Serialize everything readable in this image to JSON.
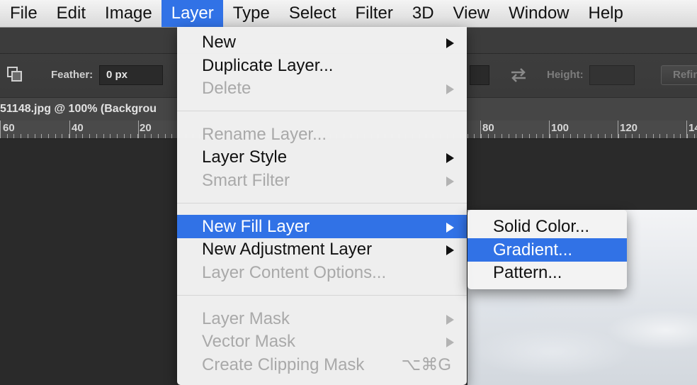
{
  "menubar": {
    "items": [
      {
        "label": "File"
      },
      {
        "label": "Edit"
      },
      {
        "label": "Image"
      },
      {
        "label": "Layer",
        "active": true
      },
      {
        "label": "Type"
      },
      {
        "label": "Select"
      },
      {
        "label": "Filter"
      },
      {
        "label": "3D"
      },
      {
        "label": "View"
      },
      {
        "label": "Window"
      },
      {
        "label": "Help"
      }
    ]
  },
  "options": {
    "feather_label": "Feather:",
    "feather_value": "0 px",
    "height_label": "Height:",
    "refine_label": "Refine"
  },
  "document": {
    "tab_title": "51148.jpg @ 100% (Backgrou"
  },
  "ruler": {
    "labels": [
      "60",
      "40",
      "20",
      "80",
      "100",
      "120",
      "14"
    ]
  },
  "layer_menu": {
    "new": "New",
    "duplicate": "Duplicate Layer...",
    "delete": "Delete",
    "rename": "Rename Layer...",
    "layer_style": "Layer Style",
    "smart_filter": "Smart Filter",
    "new_fill_layer": "New Fill Layer",
    "new_adjustment_layer": "New Adjustment Layer",
    "layer_content_options": "Layer Content Options...",
    "layer_mask": "Layer Mask",
    "vector_mask": "Vector Mask",
    "create_clipping_mask": "Create Clipping Mask",
    "create_clipping_mask_shortcut": "⌥⌘G"
  },
  "fill_submenu": {
    "solid_color": "Solid Color...",
    "gradient": "Gradient...",
    "pattern": "Pattern..."
  },
  "colors": {
    "menu_highlight": "#3172e6",
    "menu_background": "#f3f3f3",
    "disabled_text": "#a9a9a9",
    "workspace": "#2b2b2b"
  }
}
